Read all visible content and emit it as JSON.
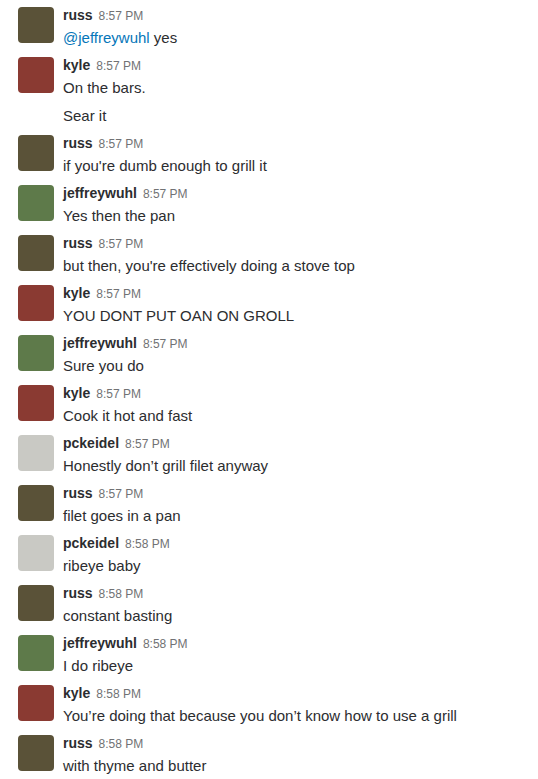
{
  "messages": [
    {
      "user": "russ",
      "time": "8:57 PM",
      "color": "#5a5238",
      "mention": "@jeffreywuhl",
      "lines": [
        "yes"
      ]
    },
    {
      "user": "kyle",
      "time": "8:57 PM",
      "color": "#8a3a32",
      "lines": [
        "On the bars.",
        "Sear it"
      ]
    },
    {
      "user": "russ",
      "time": "8:57 PM",
      "color": "#5a5238",
      "lines": [
        "if you're dumb enough to grill it"
      ]
    },
    {
      "user": "jeffreywuhl",
      "time": "8:57 PM",
      "color": "#5e7a4a",
      "lines": [
        "Yes then the pan"
      ]
    },
    {
      "user": "russ",
      "time": "8:57 PM",
      "color": "#5a5238",
      "lines": [
        "but then, you're effectively doing a stove top"
      ]
    },
    {
      "user": "kyle",
      "time": "8:57 PM",
      "color": "#8a3a32",
      "lines": [
        "YOU DONT PUT OAN ON GROLL"
      ]
    },
    {
      "user": "jeffreywuhl",
      "time": "8:57 PM",
      "color": "#5e7a4a",
      "lines": [
        "Sure you do"
      ]
    },
    {
      "user": "kyle",
      "time": "8:57 PM",
      "color": "#8a3a32",
      "lines": [
        "Cook it hot and fast"
      ]
    },
    {
      "user": "pckeidel",
      "time": "8:57 PM",
      "color": "#c9c9c4",
      "lines": [
        "Honestly don’t grill filet anyway"
      ]
    },
    {
      "user": "russ",
      "time": "8:57 PM",
      "color": "#5a5238",
      "lines": [
        "filet goes in a pan"
      ]
    },
    {
      "user": "pckeidel",
      "time": "8:58 PM",
      "color": "#c9c9c4",
      "lines": [
        "ribeye baby"
      ]
    },
    {
      "user": "russ",
      "time": "8:58 PM",
      "color": "#5a5238",
      "lines": [
        "constant basting"
      ]
    },
    {
      "user": "jeffreywuhl",
      "time": "8:58 PM",
      "color": "#5e7a4a",
      "lines": [
        "I do ribeye"
      ]
    },
    {
      "user": "kyle",
      "time": "8:58 PM",
      "color": "#8a3a32",
      "lines": [
        "You’re doing that because you don’t know how to use a grill"
      ]
    },
    {
      "user": "russ",
      "time": "8:58 PM",
      "color": "#5a5238",
      "lines": [
        "with thyme and butter"
      ]
    }
  ]
}
